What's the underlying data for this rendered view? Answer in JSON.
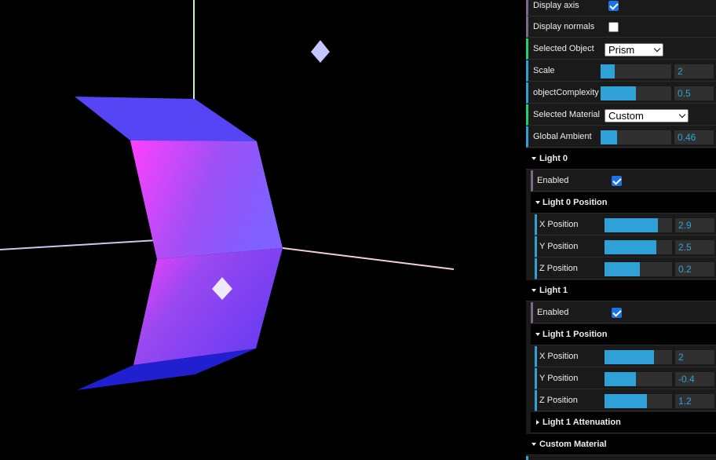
{
  "viewport": {
    "axis_colors": {
      "y_axis": "#c6f0c6",
      "x_axis": "#f0d2d2",
      "z_axis": "#c8c8f0"
    },
    "object_colors": {
      "top_face": "#5545f5",
      "front_face": "#c040f0",
      "highlight": "#ff40ff",
      "bottom_face": "#2020d0"
    },
    "light_marker_color": "#c6c6ff"
  },
  "gui": {
    "display_axis": {
      "label": "Display axis",
      "checked": true
    },
    "display_normals": {
      "label": "Display normals",
      "checked": false
    },
    "selected_object": {
      "label": "Selected Object",
      "value": "Prism"
    },
    "scale": {
      "label": "Scale",
      "value": "2",
      "fill": 0.2
    },
    "object_complexity": {
      "label": "objectComplexity",
      "value": "0.5",
      "fill": 0.5
    },
    "selected_material": {
      "label": "Selected Material",
      "value": "Custom"
    },
    "global_ambient": {
      "label": "Global Ambient",
      "value": "0.46",
      "fill": 0.23
    },
    "light0": {
      "title": "Light 0",
      "enabled": {
        "label": "Enabled",
        "checked": true
      },
      "position_folder": "Light 0 Position",
      "x": {
        "label": "X Position",
        "value": "2.9",
        "fill": 0.79
      },
      "y": {
        "label": "Y Position",
        "value": "2.5",
        "fill": 0.76
      },
      "z": {
        "label": "Z Position",
        "value": "0.2",
        "fill": 0.52
      }
    },
    "light1": {
      "title": "Light 1",
      "enabled": {
        "label": "Enabled",
        "checked": true
      },
      "position_folder": "Light 1 Position",
      "x": {
        "label": "X Position",
        "value": "2",
        "fill": 0.73
      },
      "y": {
        "label": "Y Position",
        "value": "-0.4",
        "fill": 0.47
      },
      "z": {
        "label": "Z Position",
        "value": "1.2",
        "fill": 0.63
      },
      "attenuation_folder": "Light 1 Attenuation"
    },
    "custom_material": {
      "title": "Custom Material"
    },
    "accent_colors": {
      "number": "#2fa1d6",
      "boolean": "#806787",
      "option": "#1ed36f",
      "checkbox": "#1a73e8"
    }
  }
}
